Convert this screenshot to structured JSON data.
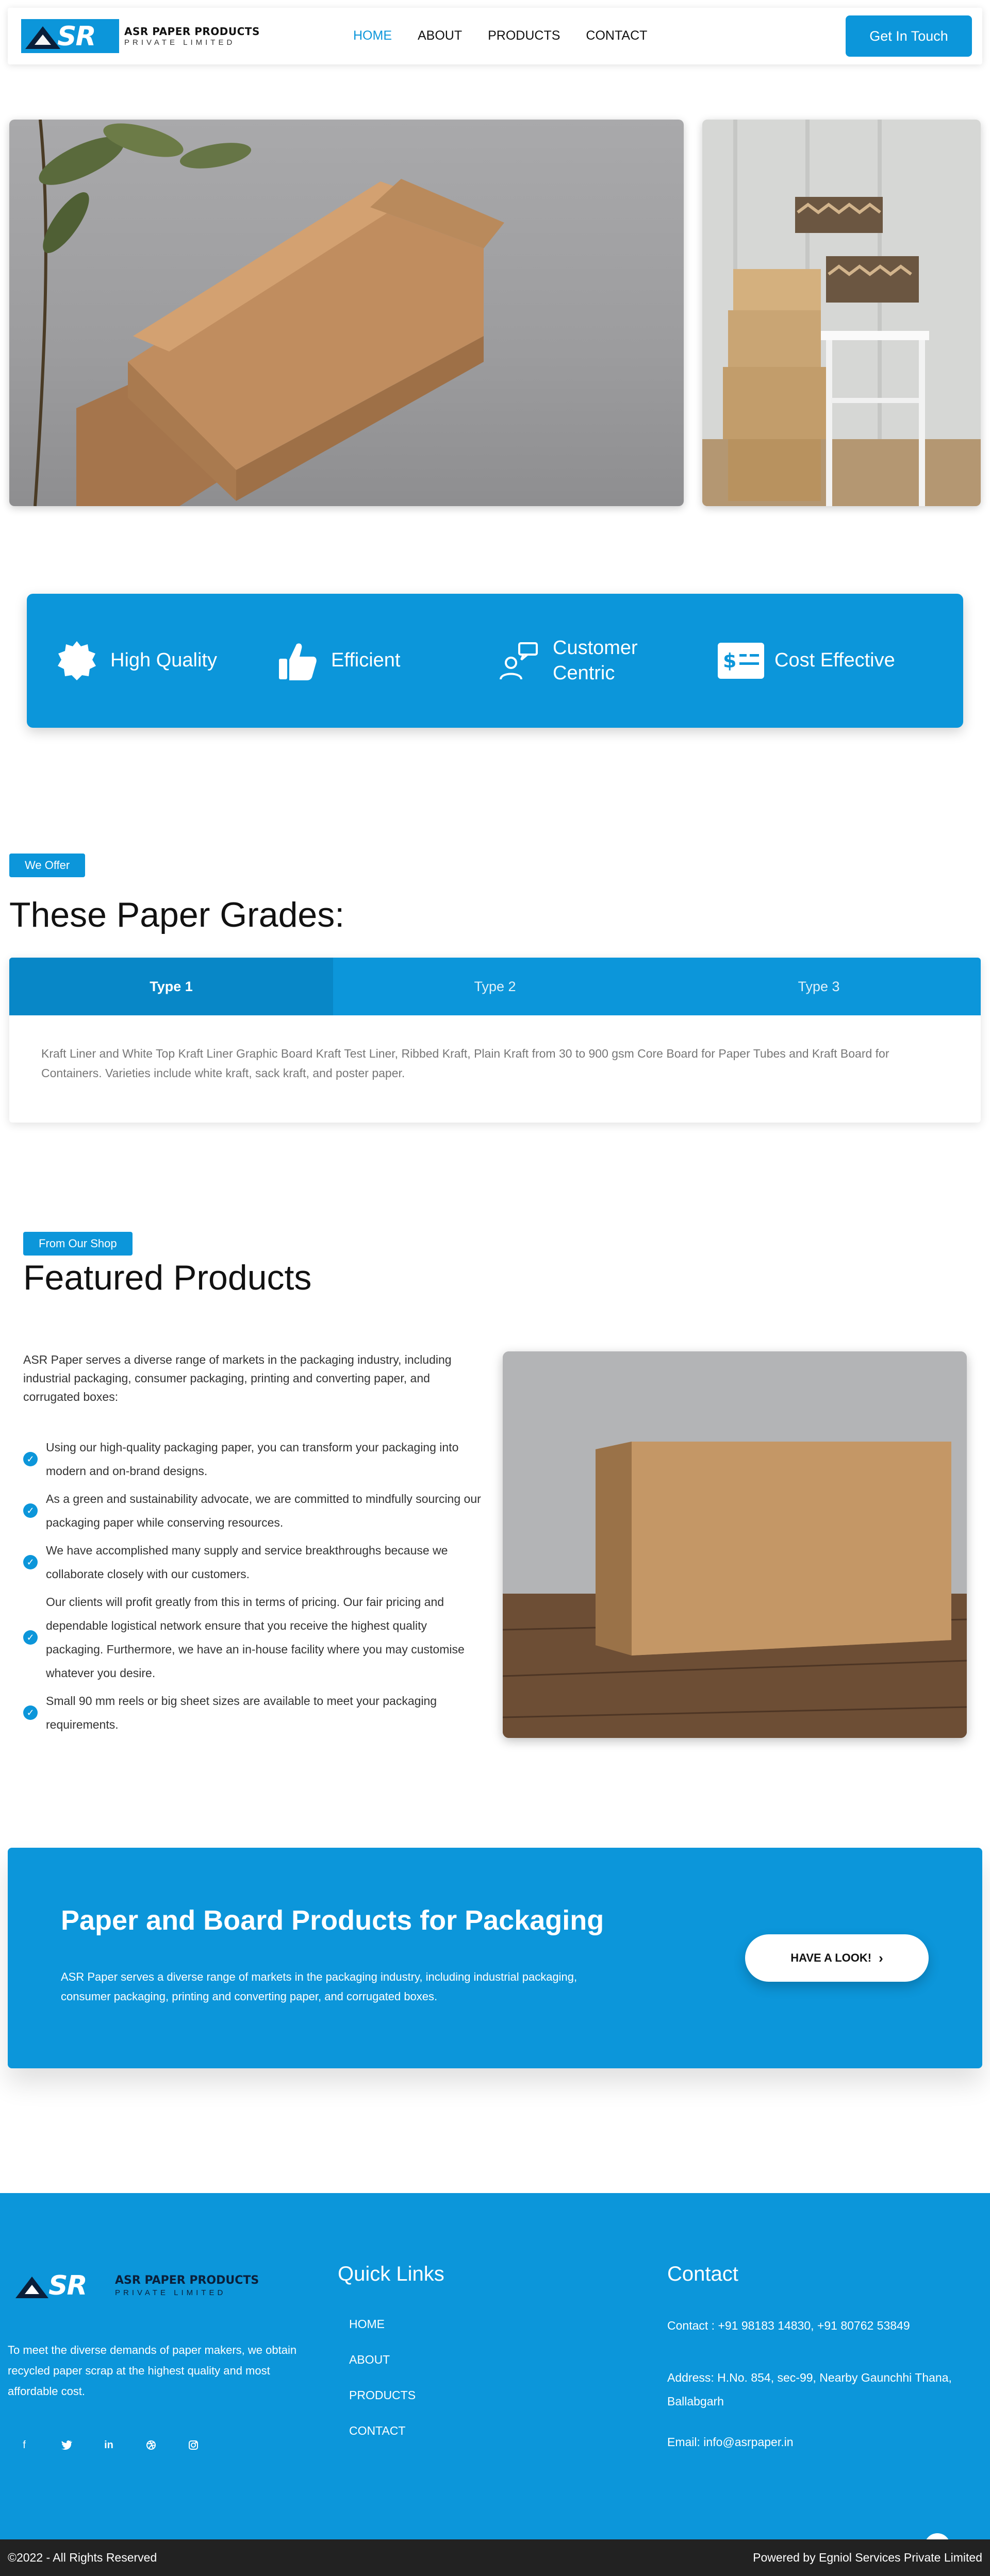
{
  "brand": {
    "name_line1": "ASR PAPER PRODUCTS",
    "name_line2": "PRIVATE LIMITED",
    "logo_mark": "SR"
  },
  "nav": {
    "items": [
      "HOME",
      "ABOUT",
      "PRODUCTS",
      "CONTACT"
    ],
    "active": "HOME"
  },
  "header": {
    "cta_label": "Get In Touch"
  },
  "features": [
    {
      "icon": "badge-check-icon",
      "label": "High Quality"
    },
    {
      "icon": "thumbs-up-icon",
      "label": "Efficient"
    },
    {
      "icon": "user-chat-icon",
      "label": "Customer Centric"
    },
    {
      "icon": "dollar-bill-icon",
      "label": "Cost Effective"
    }
  ],
  "grades": {
    "badge": "We Offer",
    "title": "These Paper Grades:",
    "tabs": [
      "Type 1",
      "Type 2",
      "Type 3"
    ],
    "active_tab": "Type 1",
    "content": "Kraft Liner and White Top Kraft Liner Graphic Board Kraft Test Liner, Ribbed Kraft, Plain Kraft from 30 to 900 gsm Core Board for Paper Tubes and Kraft Board for Containers. Varieties include white kraft, sack kraft, and poster paper."
  },
  "featured": {
    "badge": "From Our Shop",
    "title": "Featured Products",
    "intro": "ASR Paper serves a diverse range of markets in the packaging industry, including industrial packaging, consumer packaging, printing and converting paper, and corrugated boxes:",
    "points": [
      "Using our high-quality packaging paper, you can transform your packaging into modern and on-brand designs.",
      "As a green and sustainability advocate, we are committed to mindfully sourcing our packaging paper while conserving resources.",
      "We have accomplished many supply and service breakthroughs because we collaborate closely with our customers.",
      "Our clients will profit greatly from this in terms of pricing. Our fair pricing and dependable logistical network ensure that you receive the highest quality packaging. Furthermore, we have an in-house facility where you may customise whatever you desire.",
      "Small 90 mm reels or big sheet sizes are available to meet your packaging requirements."
    ]
  },
  "cta": {
    "title": "Paper and Board Products for Packaging",
    "description": "ASR Paper serves a diverse range of markets in the packaging industry, including industrial packaging, consumer packaging, printing and converting paper, and corrugated boxes.",
    "button_label": "HAVE A LOOK!"
  },
  "footer": {
    "about": "To meet the diverse demands of paper makers, we obtain recycled paper scrap at the highest quality and most affordable cost.",
    "socials": [
      "facebook-icon",
      "twitter-icon",
      "linkedin-icon",
      "dribbble-icon",
      "instagram-icon"
    ],
    "quick_links_title": "Quick Links",
    "quick_links": [
      "HOME",
      "ABOUT",
      "PRODUCTS",
      "CONTACT"
    ],
    "contact_title": "Contact",
    "contact_phone": "Contact : +91 98183 14830,  +91 80762 53849",
    "contact_address": "Address: H.No. 854, sec-99, Nearby Gaunchhi Thana, Ballabgarh",
    "contact_email": "Email: info@asrpaper.in",
    "copyright": "©2022 - All Rights Reserved",
    "powered_by": "Powered by Egniol Services Private Limited"
  },
  "colors": {
    "accent": "#0c96da",
    "accent_dark": "#0887c7",
    "bottom_bar": "#222222"
  }
}
